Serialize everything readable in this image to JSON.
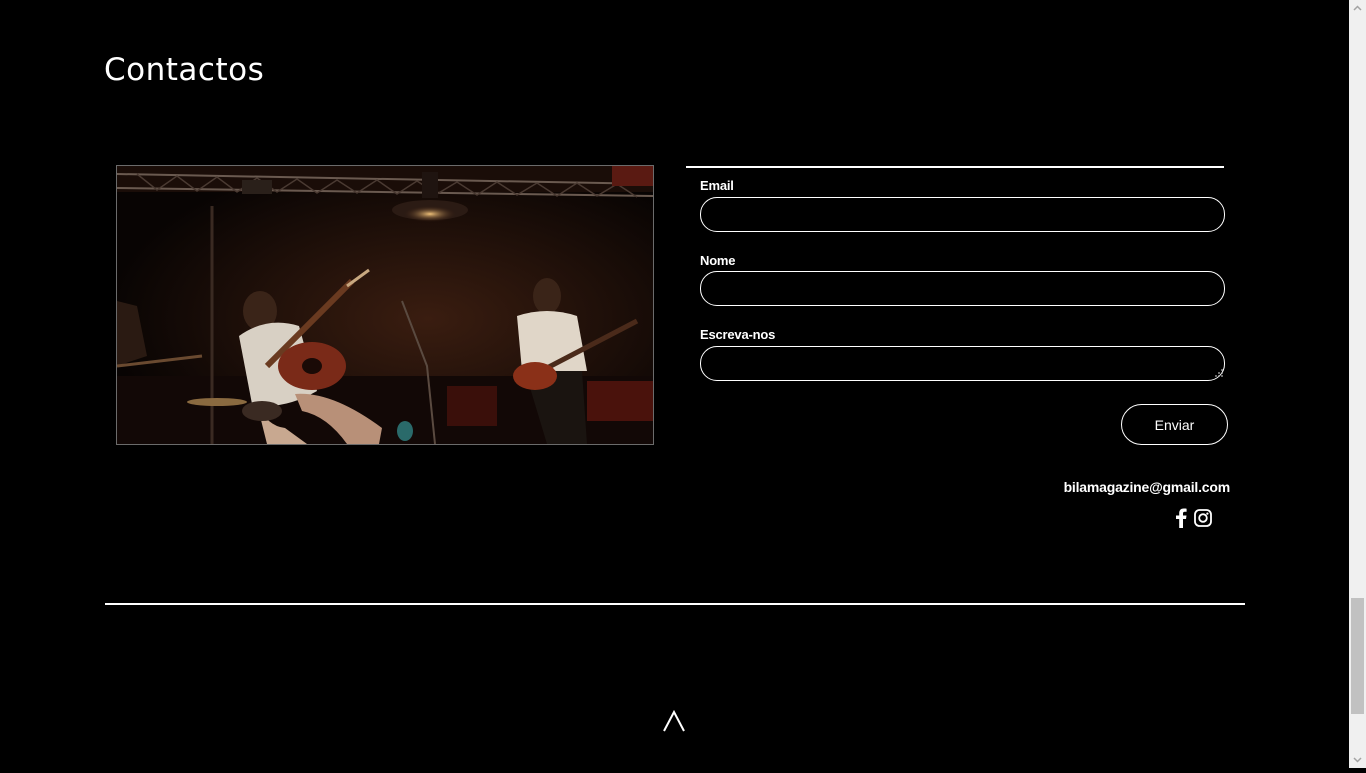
{
  "page": {
    "title": "Contactos"
  },
  "form": {
    "email_label": "Email",
    "email_value": "",
    "name_label": "Nome",
    "name_value": "",
    "message_label": "Escreva-nos",
    "message_value": "",
    "submit_label": "Enviar"
  },
  "contact": {
    "email": "bilamagazine@gmail.com"
  },
  "social": {
    "icons": [
      "facebook-icon",
      "instagram-icon"
    ]
  },
  "footer": {
    "back_to_top_icon": "caret-up-icon"
  },
  "colors": {
    "background": "#000000",
    "foreground": "#ffffff",
    "scrollbar_track": "#f0f0f0",
    "scrollbar_thumb": "#c1c1c1"
  }
}
